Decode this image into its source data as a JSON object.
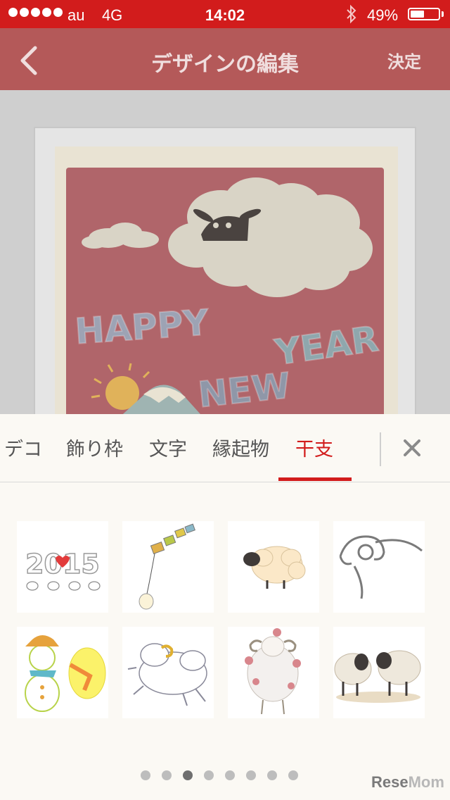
{
  "status_bar": {
    "carrier": "au",
    "network": "4G",
    "time": "14:02",
    "battery": "49%",
    "battery_level": 0.49
  },
  "nav": {
    "title": "デザインの編集",
    "done_label": "決定",
    "back_icon": "chevron-left-icon"
  },
  "card": {
    "word1": "HAPPY",
    "word2": "NEW",
    "word3": "YEAR",
    "colors": {
      "background": "#b0656a",
      "paper": "#e9e3d3",
      "cloud": "#d9d4c6"
    }
  },
  "tabs": [
    {
      "label": "デコ"
    },
    {
      "label": "飾り枠"
    },
    {
      "label": "文字"
    },
    {
      "label": "縁起物"
    },
    {
      "label": "干支",
      "active": true
    }
  ],
  "grid": {
    "row1": [
      {
        "name": "sheep-2015-sticker",
        "text": "2015"
      },
      {
        "name": "sheep-kite-sticker"
      },
      {
        "name": "fluffy-sheep-sticker"
      },
      {
        "name": "ram-ink-sticker"
      }
    ],
    "row2": [
      {
        "name": "snowman-sheep-sticker"
      },
      {
        "name": "leaping-sheep-sticker"
      },
      {
        "name": "flower-ram-sticker"
      },
      {
        "name": "two-sheep-sticker"
      }
    ]
  },
  "pager": {
    "pages": 8,
    "current": 3
  },
  "watermark": {
    "prefix": "Rese",
    "suffix": "Mom"
  },
  "accent_color": "#d21c1c"
}
